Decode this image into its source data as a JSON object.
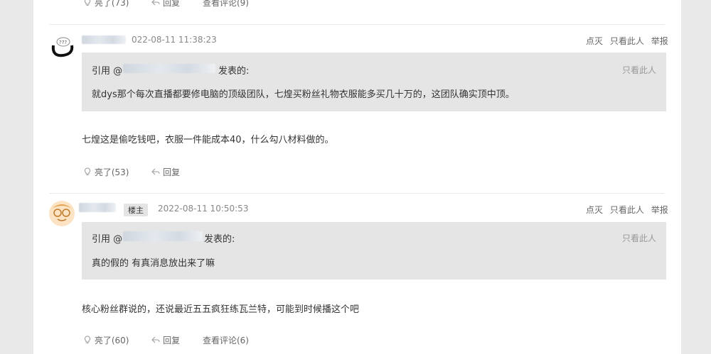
{
  "top_actions": {
    "like_label": "亮了(73)",
    "reply_label": "回复",
    "view_comments_label": "查看评论(9)"
  },
  "posts": [
    {
      "user_name": "",
      "timestamp": "022-08-11 11:38:23",
      "menu": {
        "dislike": "点灭",
        "only_this": "只看此人",
        "report": "举报"
      },
      "quote": {
        "prefix": "引用 @",
        "suffix": "发表的:",
        "only_this": "只看此人",
        "text": "就dys那个每次直播都要修电脑的顶级团队，七煌买粉丝礼物衣服能多买几十万的，这团队确实顶中顶。"
      },
      "body": "七煌这是偷吃钱吧，衣服一件能成本40，什么勾八材料做的。",
      "like_label": "亮了(53)",
      "reply_label": "回复"
    },
    {
      "user_name": "",
      "badge": "楼主",
      "timestamp": "2022-08-11 10:50:53",
      "menu": {
        "dislike": "点灭",
        "only_this": "只看此人",
        "report": "举报"
      },
      "quote": {
        "prefix": "引用 @",
        "suffix": "发表的:",
        "only_this": "只看此人",
        "text": "真的假的  有真消息放出来了嘛"
      },
      "body": "核心粉丝群说的，还说最近五五疯狂练瓦兰特，可能到时候播这个吧",
      "like_label": "亮了(60)",
      "reply_label": "回复",
      "view_comments_label": "查看评论(6)"
    }
  ],
  "colors": {
    "panel": "#ffffff",
    "background": "#e9e9e9",
    "quote_bg": "#e5e5e5"
  }
}
